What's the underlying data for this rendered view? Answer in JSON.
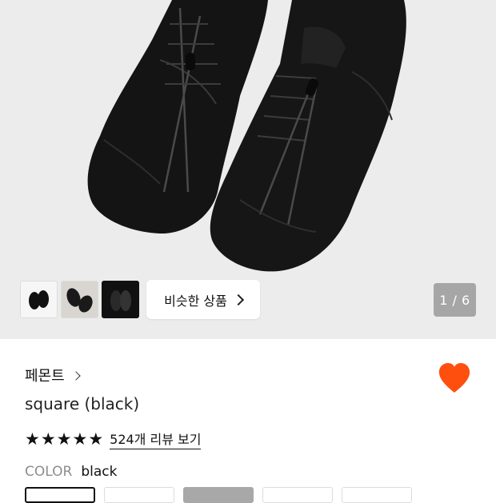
{
  "gallery": {
    "counter": "1 / 6",
    "similar_button_label": "비슷한 상품",
    "thumbnails": [
      "thumbnail-1",
      "thumbnail-2",
      "thumbnail-3"
    ]
  },
  "product": {
    "brand": "페몬트",
    "name": "square (black)",
    "rating_stars": 5,
    "review_link": "524개 리뷰 보기",
    "color_label": "COLOR",
    "color_value": "black"
  },
  "colors": {
    "accent_heart": "#ff4f0f",
    "hero_background": "#ececec",
    "counter_background": "#a6a6a6"
  },
  "icons": {
    "heart": "heart-icon",
    "star": "star-icon",
    "chevron": "chevron-right-icon"
  }
}
